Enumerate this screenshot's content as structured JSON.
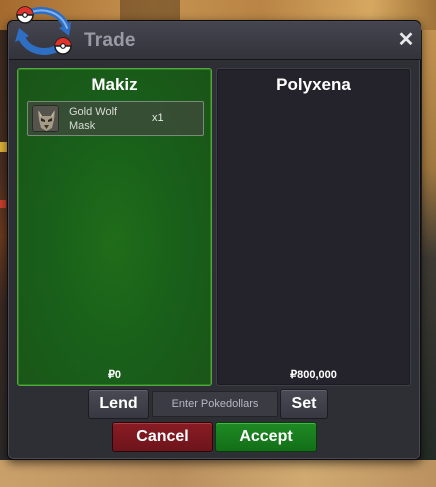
{
  "window": {
    "title": "Trade",
    "close_icon": "close-icon",
    "logo_icon": "pokeball-swap-logo"
  },
  "trade": {
    "left": {
      "name": "Makiz",
      "money": "₽0",
      "items": [
        {
          "icon": "wolf-mask-icon",
          "name": "Gold Wolf Mask",
          "qty": "x1"
        }
      ]
    },
    "right": {
      "name": "Polyxena",
      "money": "₽800,000",
      "items": []
    }
  },
  "controls": {
    "lend_label": "Lend",
    "amount_placeholder": "Enter Pokedollars",
    "set_label": "Set",
    "cancel_label": "Cancel",
    "accept_label": "Accept"
  },
  "colors": {
    "left_panel": "#1d631a",
    "right_panel": "#24232c",
    "cancel": "#7c1820",
    "accept": "#1a7d1f"
  }
}
